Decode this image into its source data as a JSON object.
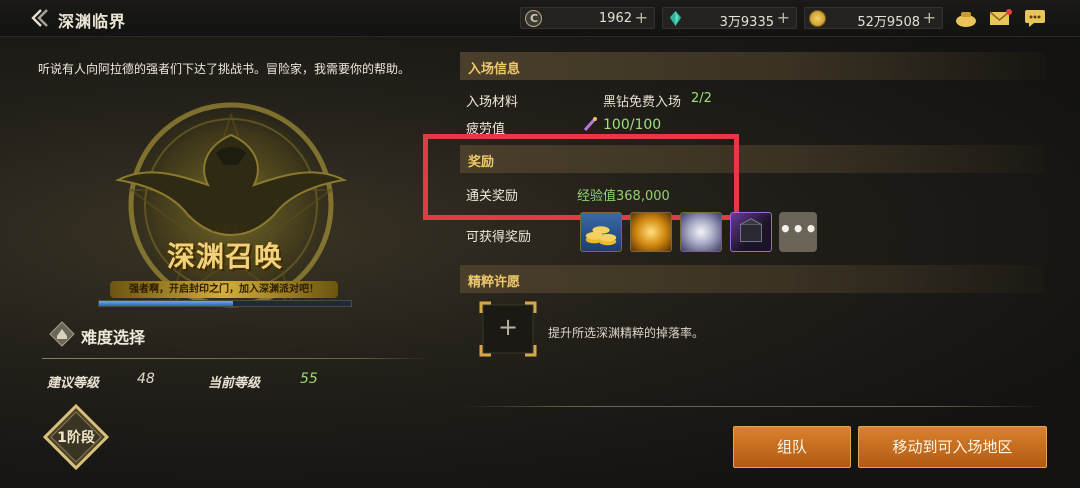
{
  "header": {
    "title": "深渊临界",
    "currencies": [
      {
        "icon": "coin-c-icon",
        "value": "1962"
      },
      {
        "icon": "green-crystal-icon",
        "value": "3万9335"
      },
      {
        "icon": "gold-coin-icon",
        "value": "52万9508"
      }
    ],
    "plus": "+"
  },
  "intro_text": "听说有人向阿拉德的强者们下达了挑战书。冒险家，我需要你的帮助。",
  "emblem": {
    "subtitle": "深渊派对",
    "title": "深渊召唤",
    "banner": "强者啊，开启封印之门，加入深渊派对吧！",
    "progress": 0.53
  },
  "difficulty": {
    "title": "难度选择",
    "recommended_label": "建议等级",
    "recommended_value": "48",
    "current_label": "当前等级",
    "current_value": "55",
    "stage": "1阶段"
  },
  "entry": {
    "header": "入场信息",
    "material_label": "入场材料",
    "material_value": "黑钻免费入场",
    "material_count": "2/2",
    "fatigue_label": "疲劳值",
    "fatigue_value": "100/100"
  },
  "reward": {
    "header": "奖励",
    "clear_label": "通关奖励",
    "clear_value": "经验值368,000",
    "obtainable_label": "可获得奖励",
    "items": [
      "gold-coins-icon",
      "golden-orb-icon",
      "silver-gem-icon",
      "dark-box-icon"
    ],
    "more": "•••"
  },
  "essence": {
    "header": "精粹许愿",
    "plus": "+",
    "hint": "提升所选深渊精粹的掉落率。"
  },
  "buttons": {
    "party": "组队",
    "move": "移动到可入场地区"
  },
  "colors": {
    "accent_gold": "#f0c86a",
    "green_value": "#8fd46a",
    "button_orange": "#c86e20",
    "highlight_red": "#e13c46"
  }
}
